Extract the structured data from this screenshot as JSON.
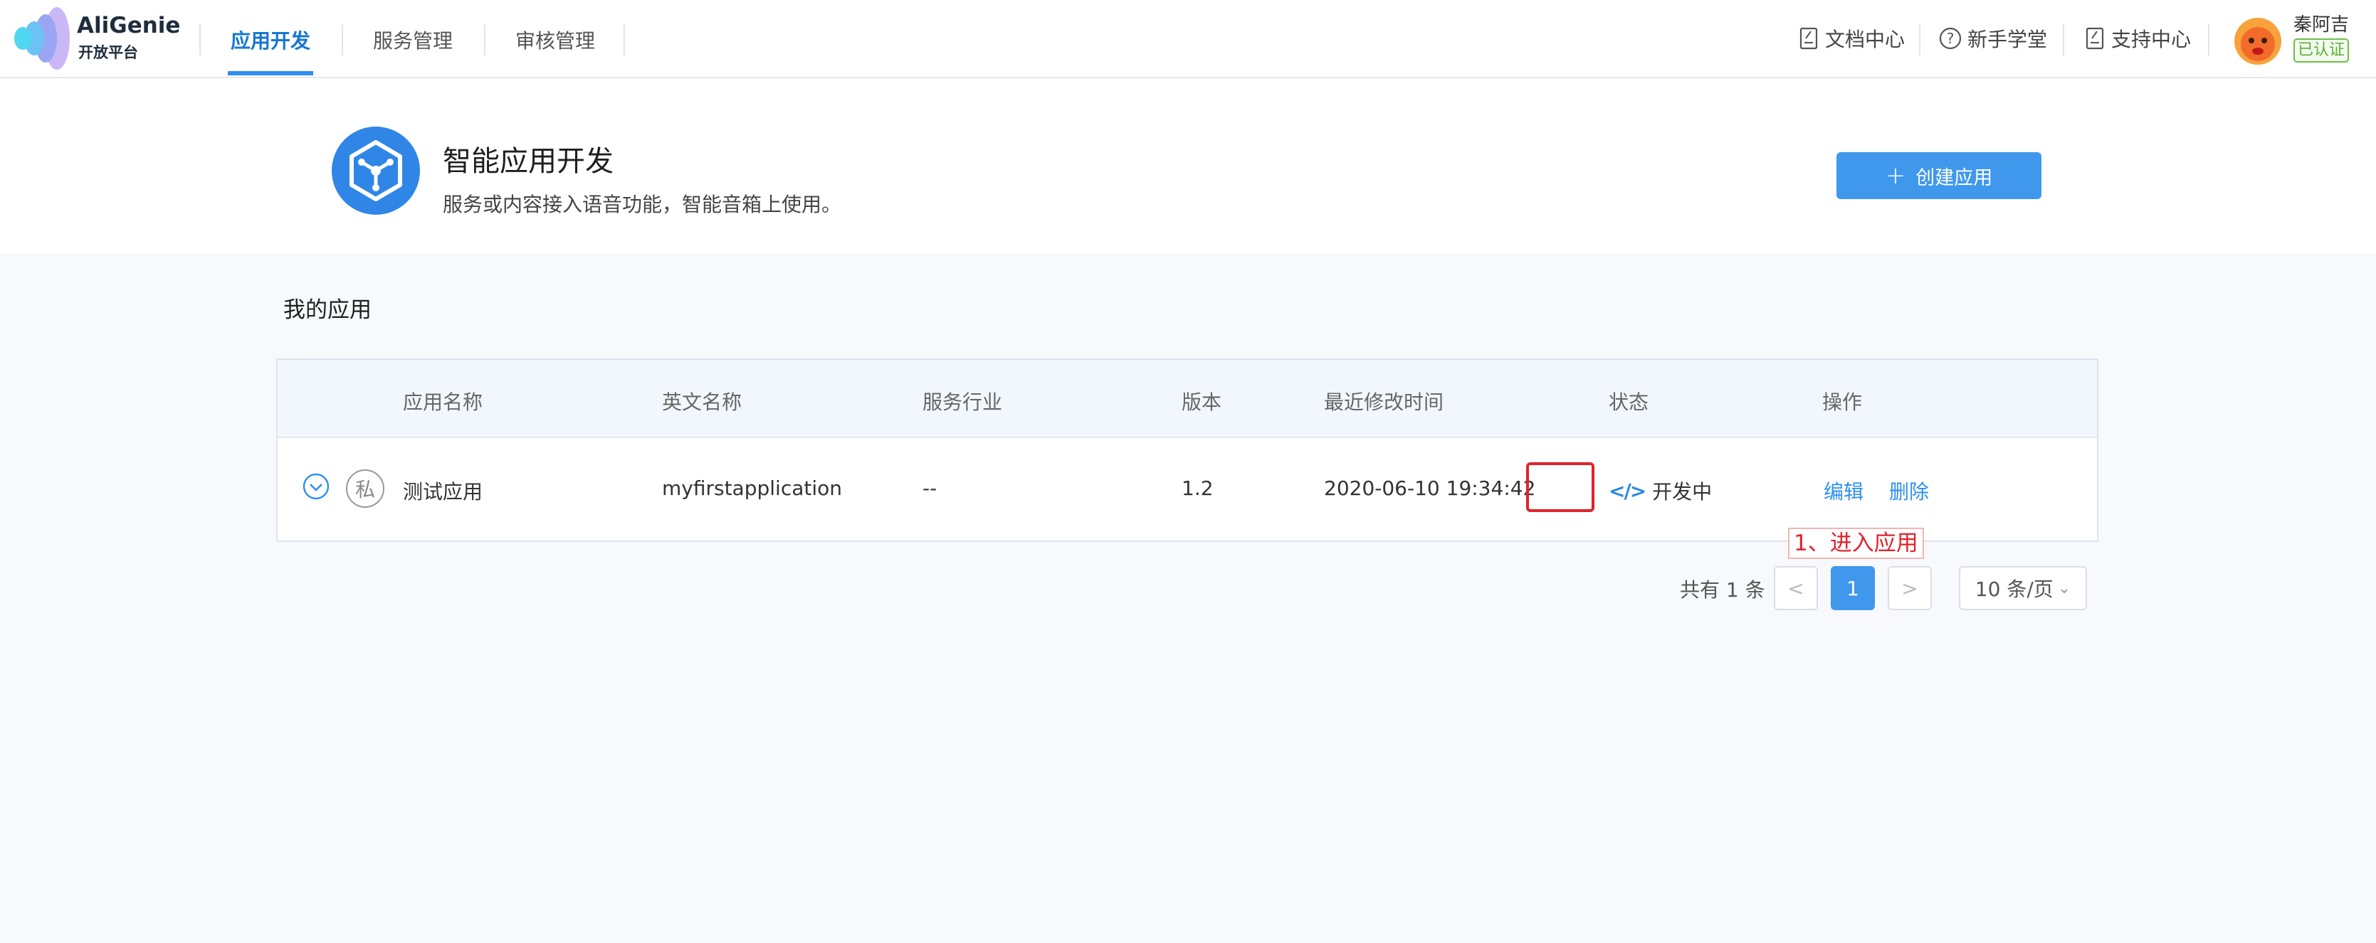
{
  "header": {
    "brand_name": "AliGenie",
    "brand_sub": "开放平台",
    "nav": [
      "应用开发",
      "服务管理",
      "审核管理"
    ],
    "links": [
      "文档中心",
      "新手学堂",
      "支持中心"
    ],
    "user_name": "秦阿吉",
    "verified_label": "已认证"
  },
  "hero": {
    "title": "智能应用开发",
    "desc": "服务或内容接入语音功能，智能音箱上使用。",
    "create_label": "创建应用"
  },
  "section_title": "我的应用",
  "table": {
    "columns": [
      "应用名称",
      "英文名称",
      "服务行业",
      "版本",
      "最近修改时间",
      "状态",
      "操作"
    ],
    "rows": [
      {
        "private_label": "私",
        "name": "测试应用",
        "english_name": "myfirstapplication",
        "industry": "--",
        "version": "1.2",
        "modified": "2020-06-10 19:34:42",
        "status": "开发中",
        "edit": "编辑",
        "delete": "删除"
      }
    ]
  },
  "annotation": "1、进入应用",
  "pagination": {
    "total": "共有 1 条",
    "current_page": "1",
    "page_size": "10 条/页"
  },
  "colors": {
    "accent": "#3f98ec",
    "highlight": "#e0232d",
    "verified": "#5ab132"
  }
}
